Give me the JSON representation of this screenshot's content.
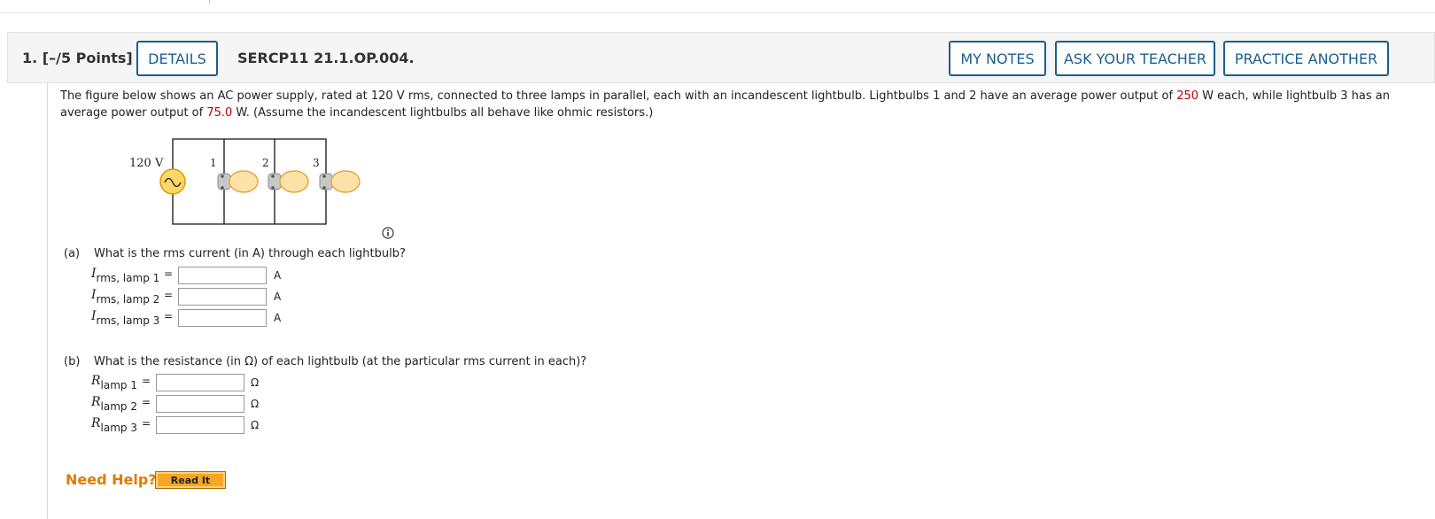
{
  "header": {
    "question_number": "1.",
    "points": "[–/5 Points]",
    "details_label": "DETAILS",
    "question_id": "SERCP11 21.1.OP.004.",
    "my_notes_label": "MY NOTES",
    "ask_teacher_label": "ASK YOUR TEACHER",
    "practice_label": "PRACTICE ANOTHER"
  },
  "prompt": {
    "text_1": "The figure below shows an AC power supply, rated at 120 V rms, connected to three lamps in parallel, each with an incandescent lightbulb. Lightbulbs 1 and 2 have an average power output of ",
    "power_12": "250",
    "text_2": " W each, while lightbulb 3 has an average power output of ",
    "power_3": "75.0",
    "text_3": " W. (Assume the incandescent lightbulbs all behave like ohmic resistors.)"
  },
  "figure": {
    "source_label": "120 V",
    "lamp_labels": [
      "1",
      "2",
      "3"
    ]
  },
  "part_a": {
    "label": "(a)",
    "question": "What is the rms current (in A) through each lightbulb?",
    "rows": [
      {
        "var": "I",
        "sub": "rms, lamp 1",
        "eq": "=",
        "value": "",
        "unit": "A"
      },
      {
        "var": "I",
        "sub": "rms, lamp 2",
        "eq": "=",
        "value": "",
        "unit": "A"
      },
      {
        "var": "I",
        "sub": "rms, lamp 3",
        "eq": "=",
        "value": "",
        "unit": "A"
      }
    ]
  },
  "part_b": {
    "label": "(b)",
    "question": "What is the resistance (in Ω) of each lightbulb (at the particular rms current in each)?",
    "rows": [
      {
        "var": "R",
        "sub": "lamp 1",
        "eq": "=",
        "value": "",
        "unit": "Ω"
      },
      {
        "var": "R",
        "sub": "lamp 2",
        "eq": "=",
        "value": "",
        "unit": "Ω"
      },
      {
        "var": "R",
        "sub": "lamp 3",
        "eq": "=",
        "value": "",
        "unit": "Ω"
      }
    ]
  },
  "help": {
    "need_help_label": "Need Help?",
    "read_it_label": "Read It"
  },
  "colors": {
    "accent": "#1b5e8c",
    "highlight_red": "#c00000",
    "help_orange": "#e07b00",
    "read_it_bg": "#f5a623"
  }
}
